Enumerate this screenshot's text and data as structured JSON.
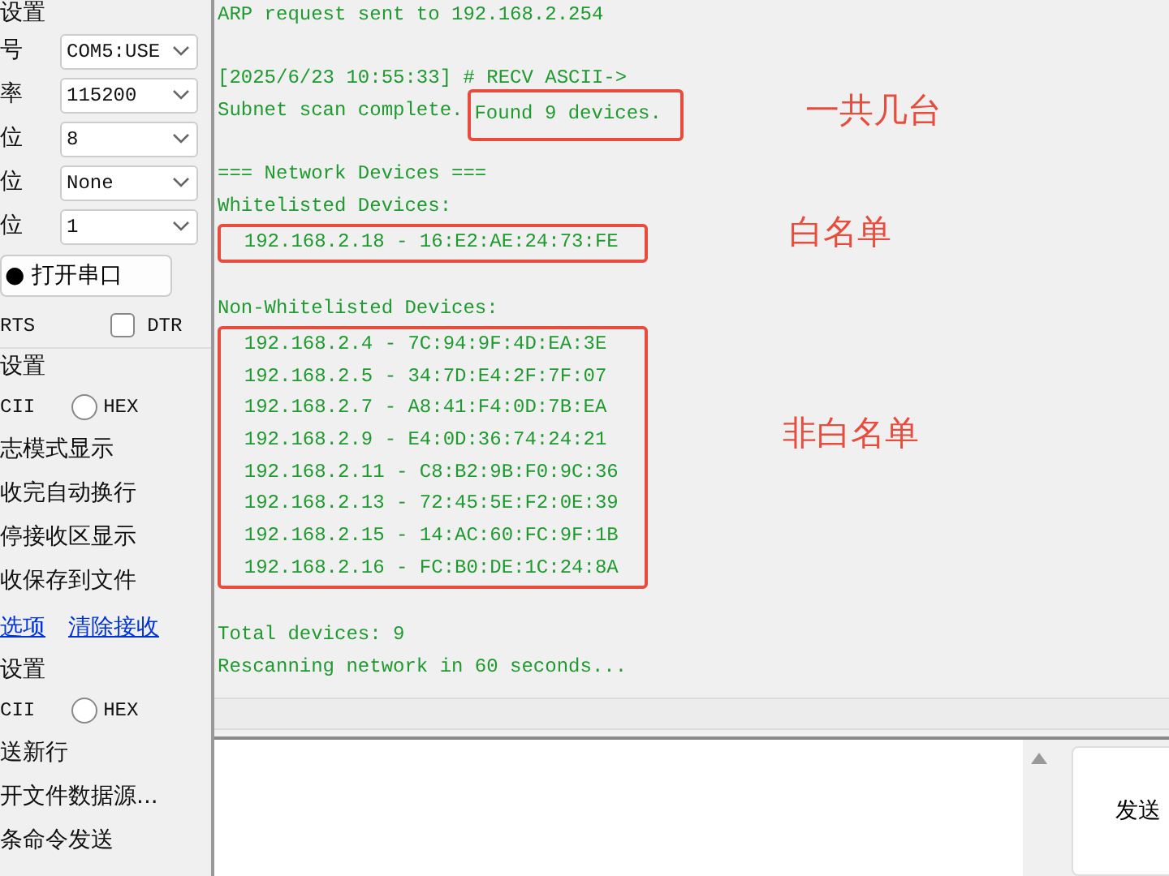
{
  "left_panel": {
    "serial_group_title": "设置",
    "fields": [
      {
        "label": "号",
        "value": "COM5:USE"
      },
      {
        "label": "率",
        "value": "115200"
      },
      {
        "label": "位",
        "value": "8"
      },
      {
        "label": "位",
        "value": "None"
      },
      {
        "label": "位",
        "value": "1"
      }
    ],
    "open_button": {
      "icon": "●",
      "label": "打开串口"
    },
    "rts_label": "RTS",
    "dtr": {
      "label": "DTR",
      "checked": false
    },
    "receive_group_title": "设置",
    "receive_ascii_label": "CII",
    "receive_hex": {
      "label": "HEX",
      "selected": false
    },
    "receive_options": [
      "志模式显示",
      "收完自动换行",
      "停接收区显示",
      "收保存到文件"
    ],
    "links": [
      "选项",
      "清除接收"
    ],
    "send_group_title": "设置",
    "send_ascii_label": "CII",
    "send_hex": {
      "label": "HEX",
      "selected": false
    },
    "send_options": [
      "送新行",
      "开文件数据源...",
      "条命令发送"
    ]
  },
  "receive_log": [
    {
      "kind": "line",
      "text": "ARP request sent to 192.168.2.254"
    },
    {
      "kind": "gap"
    },
    {
      "kind": "line",
      "text": "[2025/6/23 10:55:33] # RECV ASCII->"
    },
    {
      "kind": "highlight",
      "text": "Subnet scan complete.",
      "highlight": "Found 9 devices.",
      "annotation": "一共几台"
    },
    {
      "kind": "gap"
    },
    {
      "kind": "line",
      "text": "=== Network Devices ==="
    },
    {
      "kind": "line",
      "text": "Whitelisted Devices:"
    },
    {
      "kind": "boxed",
      "annotation": "白名单",
      "lines": [
        "  192.168.2.18 - 16:E2:AE:24:73:FE"
      ]
    },
    {
      "kind": "gap"
    },
    {
      "kind": "line",
      "text": "Non-Whitelisted Devices:"
    },
    {
      "kind": "boxed",
      "annotation": "非白名单",
      "lines": [
        "  192.168.2.4 - 7C:94:9F:4D:EA:3E",
        "  192.168.2.5 - 34:7D:E4:2F:7F:07",
        "  192.168.2.7 - A8:41:F4:0D:7B:EA",
        "  192.168.2.9 - E4:0D:36:74:24:21",
        "  192.168.2.11 - C8:B2:9B:F0:9C:36",
        "  192.168.2.13 - 72:45:5E:F2:0E:39",
        "  192.168.2.15 - 14:AC:60:FC:9F:1B",
        "  192.168.2.16 - FC:B0:DE:1C:24:8A"
      ]
    },
    {
      "kind": "gap"
    },
    {
      "kind": "line",
      "text": "Total devices: 9"
    },
    {
      "kind": "line",
      "text": "Rescanning network in 60 seconds..."
    }
  ],
  "send_button": "发送"
}
